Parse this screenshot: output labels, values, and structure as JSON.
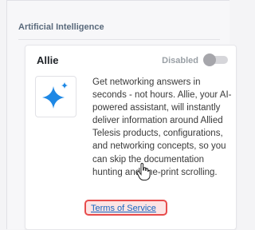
{
  "section": {
    "title": "Artificial Intelligence"
  },
  "card": {
    "title": "Allie",
    "status": "Disabled",
    "enabled": false,
    "description": "Get networking answers in seconds - not hours. Allie, your AI-powered assistant, will instantly deliver information around Allied Telesis products, configurations, and networking concepts, so you can skip the documentation hunting and fine-print scrolling.",
    "link": "Terms of Service",
    "icon": "sparkle-icon"
  },
  "colors": {
    "sparkle": "#1e88e5",
    "link": "#1565c0",
    "highlight_border": "#e74c4c"
  }
}
